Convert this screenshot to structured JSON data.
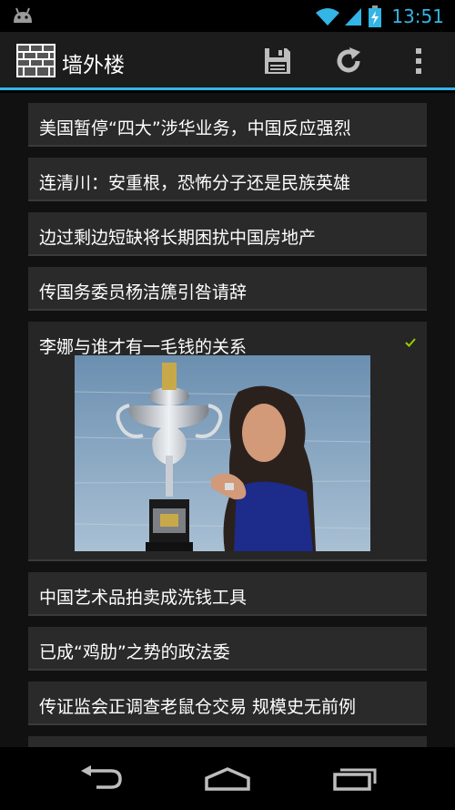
{
  "status_bar": {
    "time": "13:51",
    "accent": "#33b5e5"
  },
  "action_bar": {
    "title": "墙外楼",
    "icons": [
      "app-logo-icon",
      "save-icon",
      "refresh-icon",
      "overflow-menu-icon"
    ],
    "underline_color": "#33b5e5"
  },
  "articles": [
    {
      "title": "美国暂停“四大”涉华业务，中国反应强烈",
      "expanded": false
    },
    {
      "title": "连清川：安重根，恐怖分子还是民族英雄",
      "expanded": false
    },
    {
      "title": "边过剩边短缺将长期困扰中国房地产",
      "expanded": false
    },
    {
      "title": "传国务委员杨洁篪引咎请辞",
      "expanded": false
    },
    {
      "title": "李娜与谁才有一毛钱的关系",
      "expanded": true,
      "read": true
    },
    {
      "title": "中国艺术品拍卖成洗钱工具",
      "expanded": false
    },
    {
      "title": "已成“鸡肋”之势的政法委",
      "expanded": false
    },
    {
      "title": "传证监会正调查老鼠仓交易 规模史无前例",
      "expanded": false
    },
    {
      "title": "",
      "expanded": false
    }
  ],
  "nav_bar": {
    "icons": [
      "back-icon",
      "home-icon",
      "recents-icon"
    ]
  }
}
